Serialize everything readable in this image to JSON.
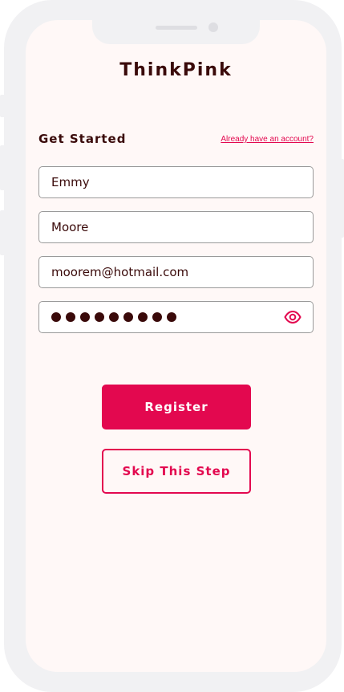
{
  "app": {
    "title": "ThinkPink"
  },
  "form": {
    "heading": "Get Started",
    "account_link": "Already have an account?",
    "first_name": "Emmy",
    "last_name": "Moore",
    "email": "moorem@hotmail.com",
    "password_mask_count": 9,
    "password_visibility_icon": "eye-icon"
  },
  "buttons": {
    "register": "Register",
    "skip": "Skip This Step"
  },
  "colors": {
    "accent": "#e3084f",
    "text": "#3a0a0a",
    "screen_background": "#fff8f7",
    "device_frame": "#f1f1f3"
  }
}
